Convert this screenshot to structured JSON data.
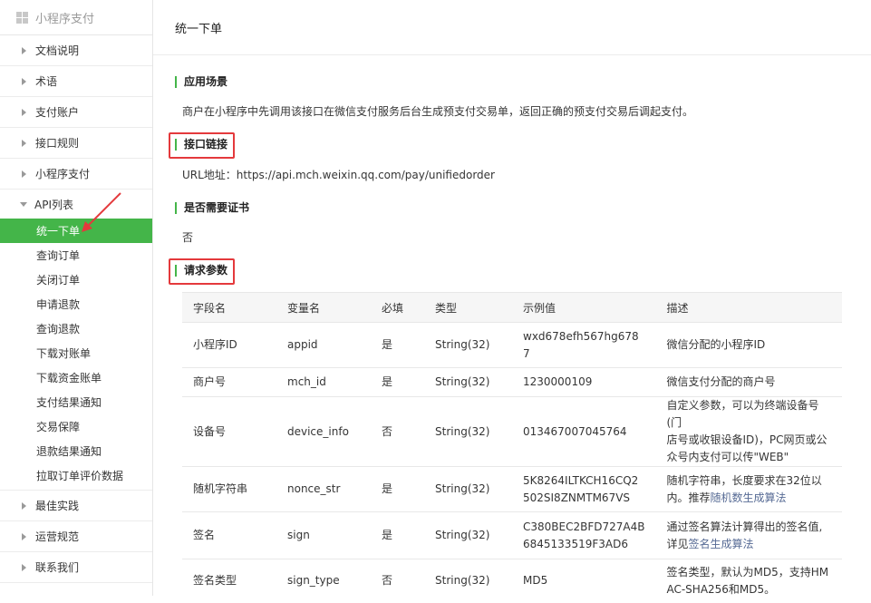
{
  "sidebar": {
    "header": "小程序支付",
    "top_items": [
      "文档说明",
      "术语",
      "支付账户",
      "接口规则",
      "小程序支付"
    ],
    "group_label": "API列表",
    "sub_items": [
      "统一下单",
      "查询订单",
      "关闭订单",
      "申请退款",
      "查询退款",
      "下载对账单",
      "下载资金账单",
      "支付结果通知",
      "交易保障",
      "退款结果通知",
      "拉取订单评价数据"
    ],
    "bottom_items": [
      "最佳实践",
      "运营规范",
      "联系我们"
    ],
    "active": "统一下单"
  },
  "page": {
    "title": "统一下单",
    "sec1_title": "应用场景",
    "sec1_text": "商户在小程序中先调用该接口在微信支付服务后台生成预支付交易单，返回正确的预支付交易后调起支付。",
    "sec2_title": "接口链接",
    "sec2_text": "URL地址：https://api.mch.weixin.qq.com/pay/unifiedorder",
    "sec3_title": "是否需要证书",
    "sec3_text": "否",
    "sec4_title": "请求参数"
  },
  "table": {
    "headers": [
      "字段名",
      "变量名",
      "必填",
      "类型",
      "示例值",
      "描述"
    ],
    "rows": [
      {
        "name": "小程序ID",
        "var": "appid",
        "req": "是",
        "type": "String(32)",
        "ex_lines": [
          "wxd678efh567hg678",
          "7"
        ],
        "desc_lines": [
          "微信分配的小程序ID"
        ],
        "link": "",
        "desc_after": ""
      },
      {
        "name": "商户号",
        "var": "mch_id",
        "req": "是",
        "type": "String(32)",
        "ex_lines": [
          "1230000109"
        ],
        "desc_lines": [
          "微信支付分配的商户号"
        ],
        "link": "",
        "desc_after": ""
      },
      {
        "name": "设备号",
        "var": "device_info",
        "req": "否",
        "type": "String(32)",
        "ex_lines": [
          "013467007045764"
        ],
        "desc_lines": [
          "自定义参数，可以为终端设备号(门",
          "店号或收银设备ID)，PC网页或公",
          "众号内支付可以传\"WEB\""
        ],
        "link": "",
        "desc_after": ""
      },
      {
        "name": "随机字符串",
        "var": "nonce_str",
        "req": "是",
        "type": "String(32)",
        "ex_lines": [
          "5K8264ILTKCH16CQ2",
          "502SI8ZNMTM67VS"
        ],
        "desc_lines": [
          "随机字符串，长度要求在32位以",
          "内。推荐"
        ],
        "link": "随机数生成算法",
        "desc_after": ""
      },
      {
        "name": "签名",
        "var": "sign",
        "req": "是",
        "type": "String(32)",
        "ex_lines": [
          "C380BEC2BFD727A4B",
          "6845133519F3AD6"
        ],
        "desc_lines": [
          "通过签名算法计算得出的签名值,",
          "详见"
        ],
        "link": "签名生成算法",
        "desc_after": ""
      },
      {
        "name": "签名类型",
        "var": "sign_type",
        "req": "否",
        "type": "String(32)",
        "ex_lines": [
          "MD5"
        ],
        "desc_lines": [
          "签名类型，默认为MD5，支持HM",
          "AC-SHA256和MD5。"
        ],
        "link": "",
        "desc_after": ""
      }
    ]
  },
  "colors": {
    "accent": "#44b549",
    "highlight": "#e4393c",
    "link": "#576b95"
  }
}
